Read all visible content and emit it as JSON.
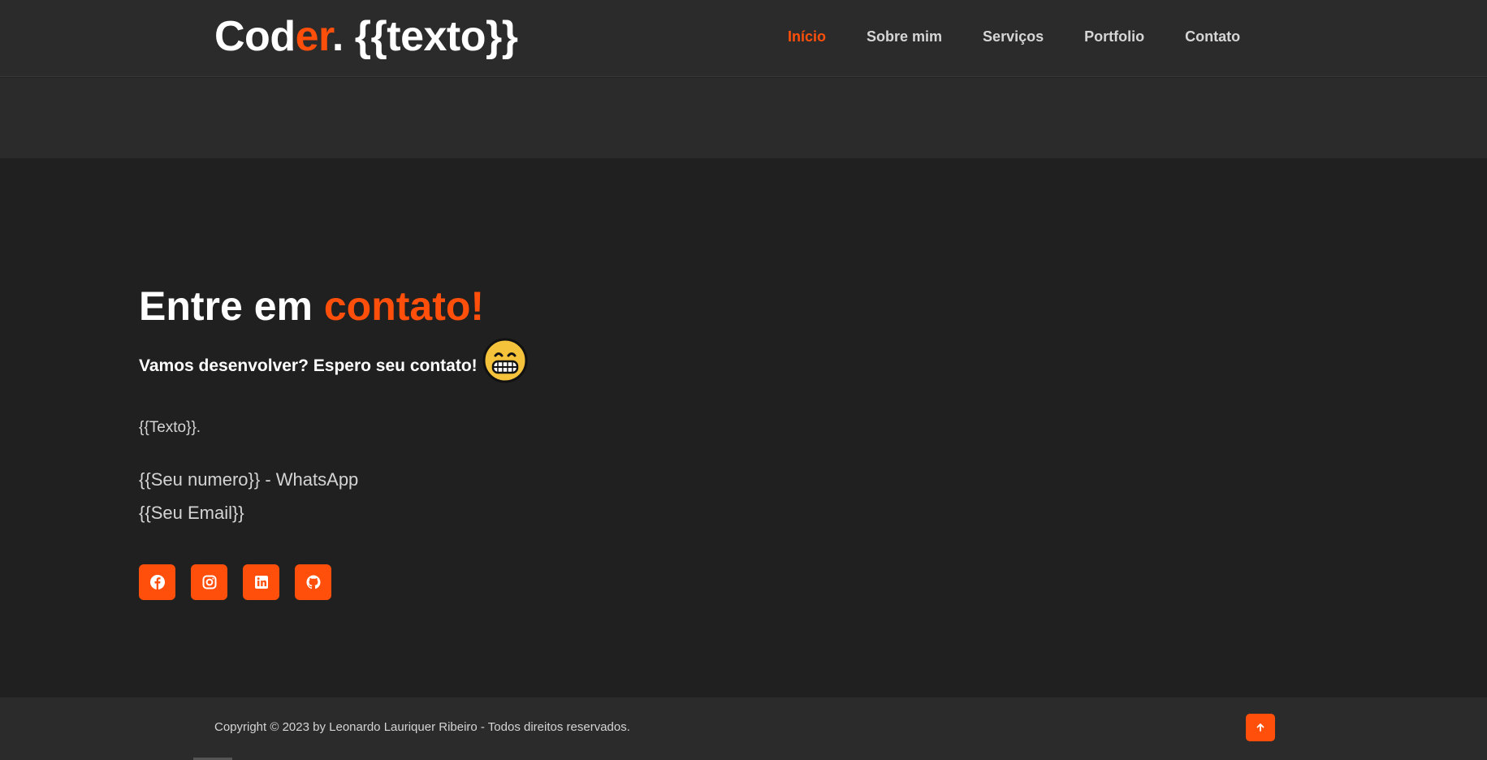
{
  "colors": {
    "accent": "#ff4f0b",
    "background": "#202020",
    "header_bg": "#2b2b2b"
  },
  "header": {
    "logo": {
      "part1": "Cod",
      "part2": "er",
      "part3": ". {{texto}}"
    },
    "nav": [
      {
        "label": "Início",
        "active": true
      },
      {
        "label": "Sobre mim",
        "active": false
      },
      {
        "label": "Serviços",
        "active": false
      },
      {
        "label": "Portfolio",
        "active": false
      },
      {
        "label": "Contato",
        "active": false
      }
    ]
  },
  "contact": {
    "title_white": "Entre em ",
    "title_accent": "contato!",
    "subtitle": "Vamos desenvolver? Espero seu contato!",
    "subtitle_emoji": "grinning-face-icon",
    "text": "{{Texto}}.",
    "phone": "{{Seu numero}} - WhatsApp",
    "email": "{{Seu Email}}",
    "socials": [
      {
        "icon": "facebook-icon"
      },
      {
        "icon": "instagram-icon"
      },
      {
        "icon": "linkedin-icon"
      },
      {
        "icon": "github-icon"
      }
    ]
  },
  "footer": {
    "copyright": "Copyright © 2023 by Leonardo Lauriquer Ribeiro - Todos direitos reservados.",
    "back_to_top_icon": "arrow-up-icon"
  }
}
